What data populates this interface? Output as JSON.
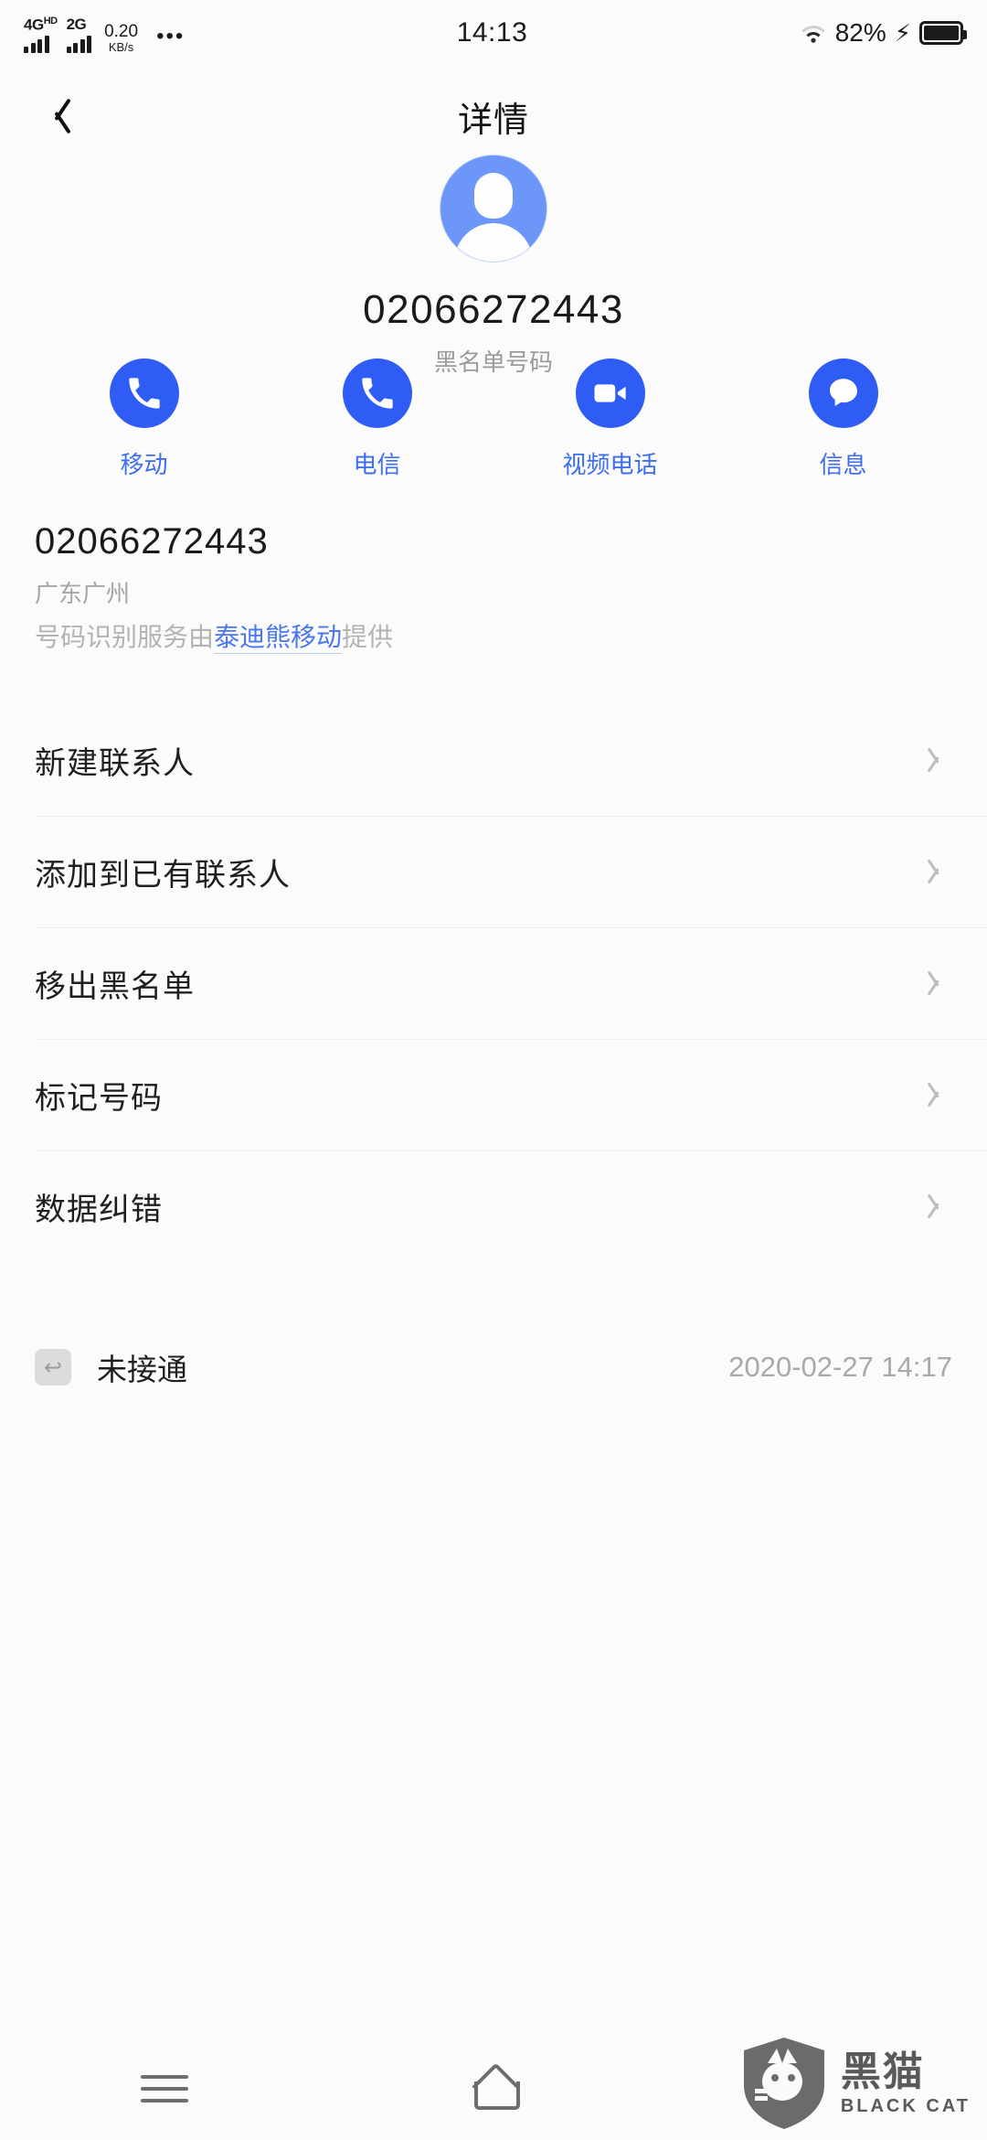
{
  "statusbar": {
    "network_primary": "4G",
    "network_primary_sup": "HD",
    "network_secondary": "2G",
    "speed_value": "0.20",
    "speed_unit": "KB/s",
    "overflow": "•••",
    "time": "14:13",
    "battery_percent": "82%",
    "charging_glyph": "⚡"
  },
  "appbar": {
    "title": "详情",
    "back_icon": "chevron-left-icon"
  },
  "profile": {
    "avatar_icon": "person-avatar-icon",
    "phone_number": "02066272443",
    "subtitle": "黑名单号码",
    "avatar_color": "#6c96f7"
  },
  "actions": [
    {
      "label": "移动",
      "icon": "phone-icon"
    },
    {
      "label": "电信",
      "icon": "phone-icon"
    },
    {
      "label": "视频电话",
      "icon": "video-camera-icon"
    },
    {
      "label": "信息",
      "icon": "message-bubble-icon"
    }
  ],
  "action_color": "#2f5cf4",
  "number_info": {
    "number": "02066272443",
    "location": "广东广州"
  },
  "provider_note": {
    "prefix": "号码识别服务由",
    "link": "泰迪熊移动",
    "suffix": "提供",
    "link_color": "#4a77ef"
  },
  "menu": [
    {
      "label": "新建联系人",
      "chevron": "chevron-right-icon"
    },
    {
      "label": "添加到已有联系人",
      "chevron": "chevron-right-icon"
    },
    {
      "label": "移出黑名单",
      "chevron": "chevron-right-icon"
    },
    {
      "label": "标记号码",
      "chevron": "chevron-right-icon"
    },
    {
      "label": "数据纠错",
      "chevron": "chevron-right-icon"
    }
  ],
  "call_log": {
    "icon": "missed-call-icon",
    "status": "未接通",
    "timestamp": "2020-02-27 14:17"
  },
  "navbar": {
    "recents_icon": "menu-icon",
    "home_icon": "home-icon"
  },
  "watermark": {
    "cn": "黑猫",
    "en": "BLACK CAT",
    "logo_icon": "black-cat-shield-icon"
  }
}
